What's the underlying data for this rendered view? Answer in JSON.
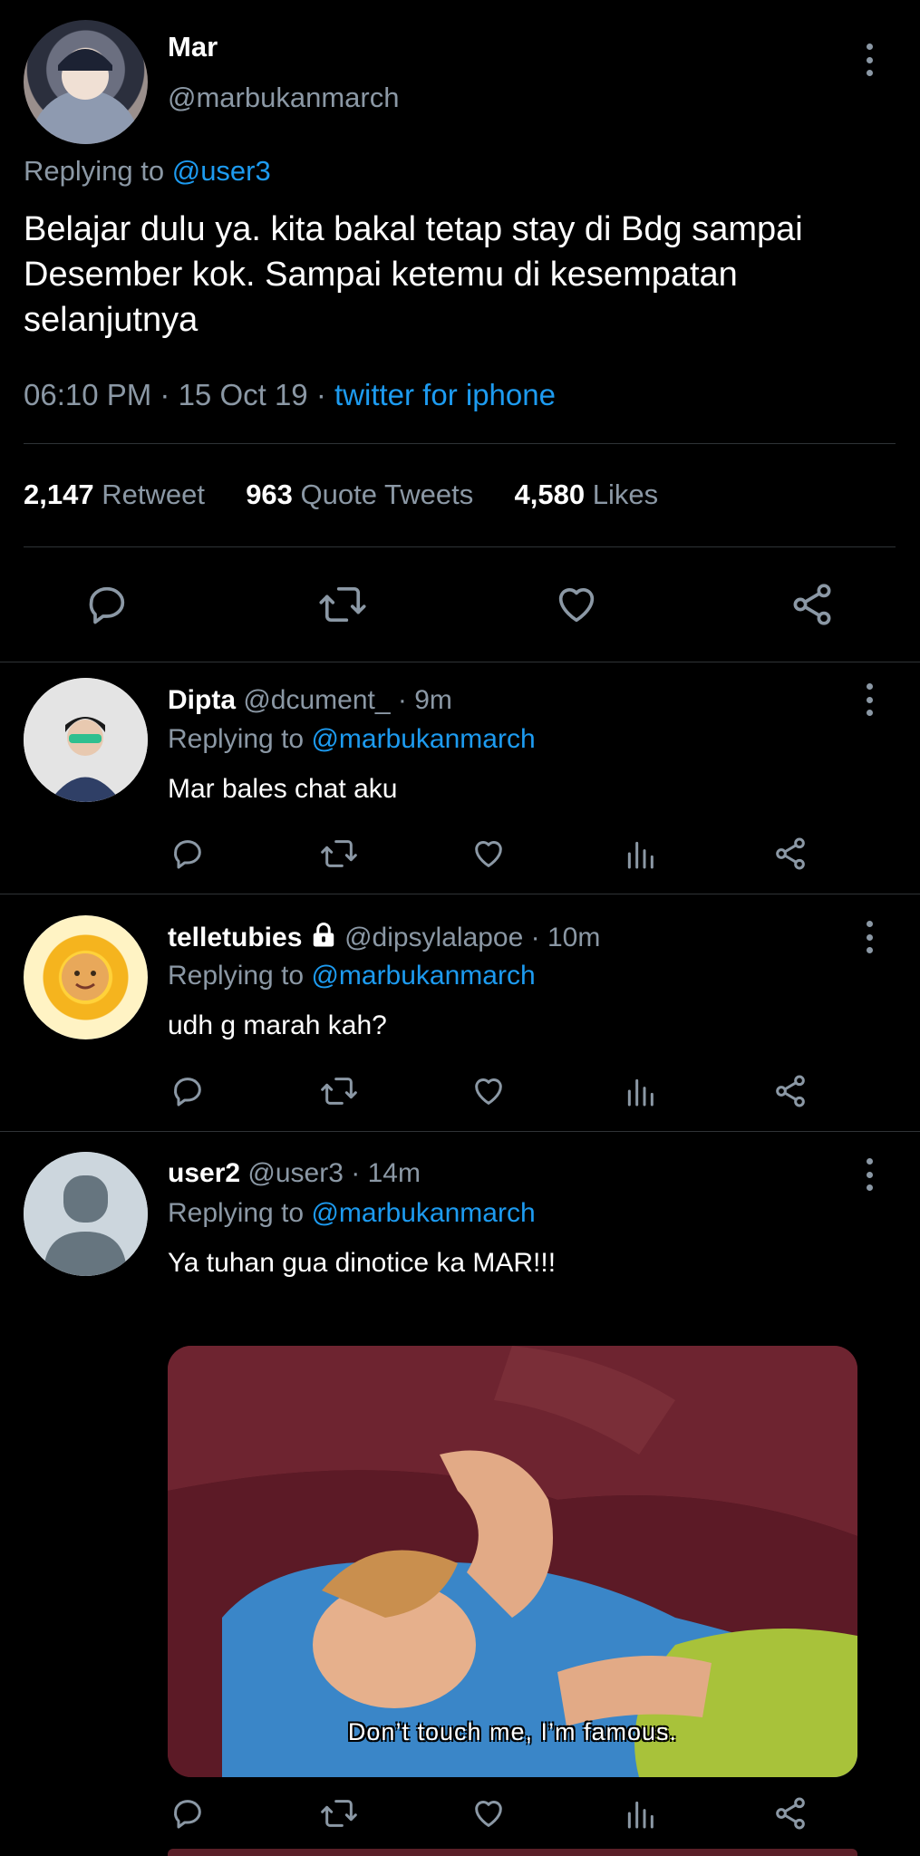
{
  "main_tweet": {
    "name": "Mar",
    "handle": "@marbukanmarch",
    "replying_prefix": "Replying to",
    "replying_to": "@user3",
    "text": "Belajar dulu ya.  kita bakal tetap stay di Bdg sampai Desember kok.  Sampai ketemu di kesempatan selanjutnya",
    "timestamp": "06:10 PM · 15 Oct 19 · ",
    "source": "twitter for iphone",
    "stats": {
      "retweets_count": "2,147",
      "retweets_label": "Retweet",
      "quotes_count": "963",
      "quotes_label": "Quote Tweets",
      "likes_count": "4,580",
      "likes_label": "Likes"
    },
    "actions": [
      "comment-icon",
      "retweet-icon",
      "heart-icon",
      "share-icon"
    ]
  },
  "replies": [
    {
      "name": "Dipta",
      "handle": "@dcument_",
      "time": "· 9m",
      "replying_prefix": "Replying to",
      "replying_to": "@marbukanmarch",
      "text": "Mar bales chat aku",
      "locked": false
    },
    {
      "name": "telletubies",
      "handle": "@dipsylalapoe",
      "time": "· 10m",
      "replying_prefix": "Replying to",
      "replying_to": "@marbukanmarch",
      "text": "udh g marah kah?",
      "locked": true
    },
    {
      "name": "user2",
      "handle": "@user3",
      "time": "· 14m",
      "replying_prefix": "Replying to",
      "replying_to": "@marbukanmarch",
      "text": "Ya tuhan gua dinotice ka MAR!!!",
      "locked": false,
      "media_caption": "Don’t touch me, I’m famous."
    }
  ],
  "colors": {
    "background": "#000000",
    "text": "#ffffff",
    "muted": "#8b98a5",
    "link": "#1d9bf0",
    "divider": "#2f3336"
  }
}
